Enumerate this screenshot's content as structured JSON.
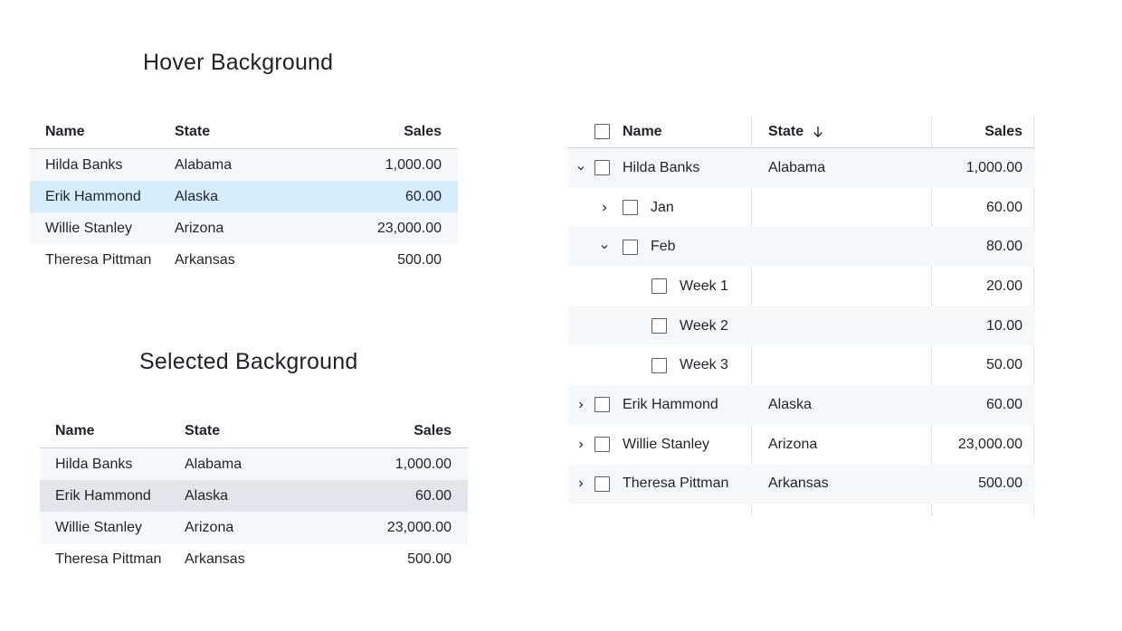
{
  "hover_section": {
    "title": "Hover Background",
    "headers": {
      "name": "Name",
      "state": "State",
      "sales": "Sales"
    },
    "rows": [
      {
        "name": "Hilda Banks",
        "state": "Alabama",
        "sales": "1,000.00"
      },
      {
        "name": "Erik Hammond",
        "state": "Alaska",
        "sales": "60.00"
      },
      {
        "name": "Willie Stanley",
        "state": "Arizona",
        "sales": "23,000.00"
      },
      {
        "name": "Theresa Pittman",
        "state": "Arkansas",
        "sales": "500.00"
      }
    ],
    "hovered_row": 1,
    "hover_color": "#d6eefb"
  },
  "selected_section": {
    "title": "Selected Background",
    "headers": {
      "name": "Name",
      "state": "State",
      "sales": "Sales"
    },
    "rows": [
      {
        "name": "Hilda Banks",
        "state": "Alabama",
        "sales": "1,000.00"
      },
      {
        "name": "Erik Hammond",
        "state": "Alaska",
        "sales": "60.00"
      },
      {
        "name": "Willie Stanley",
        "state": "Arizona",
        "sales": "23,000.00"
      },
      {
        "name": "Theresa Pittman",
        "state": "Arkansas",
        "sales": "500.00"
      }
    ],
    "selected_row": 1,
    "selected_color": "#e0e6ec"
  },
  "tree_table": {
    "headers": {
      "name": "Name",
      "state": "State",
      "sales": "Sales"
    },
    "sort_icon": "arrow-down-icon",
    "rows": [
      {
        "name": "Hilda Banks",
        "state": "Alabama",
        "sales": "1,000.00"
      },
      {
        "name": "Jan",
        "state": "",
        "sales": "60.00"
      },
      {
        "name": "Feb",
        "state": "",
        "sales": "80.00"
      },
      {
        "name": "Week 1",
        "state": "",
        "sales": "20.00"
      },
      {
        "name": "Week 2",
        "state": "",
        "sales": "10.00"
      },
      {
        "name": "Week 3",
        "state": "",
        "sales": "50.00"
      },
      {
        "name": "Erik Hammond",
        "state": "Alaska",
        "sales": "60.00"
      },
      {
        "name": "Willie Stanley",
        "state": "Arizona",
        "sales": "23,000.00"
      },
      {
        "name": "Theresa Pittman",
        "state": "Arkansas",
        "sales": "500.00"
      }
    ],
    "stripe_color": "#f5f8fb"
  }
}
